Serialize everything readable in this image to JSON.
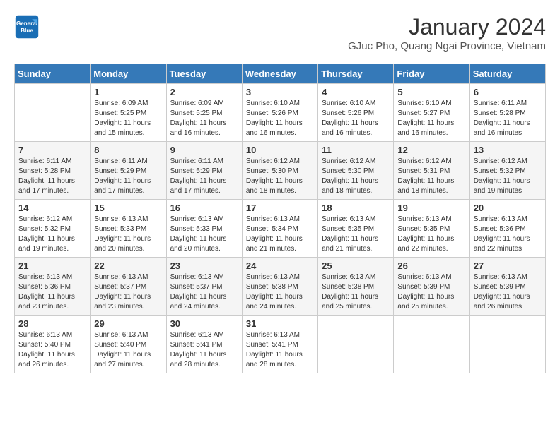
{
  "logo": {
    "line1": "General",
    "line2": "Blue"
  },
  "title": "January 2024",
  "location": "GJuc Pho, Quang Ngai Province, Vietnam",
  "days_of_week": [
    "Sunday",
    "Monday",
    "Tuesday",
    "Wednesday",
    "Thursday",
    "Friday",
    "Saturday"
  ],
  "weeks": [
    [
      {
        "day": "",
        "sunrise": "",
        "sunset": "",
        "daylight": ""
      },
      {
        "day": "1",
        "sunrise": "6:09 AM",
        "sunset": "5:25 PM",
        "daylight": "11 hours and 15 minutes."
      },
      {
        "day": "2",
        "sunrise": "6:09 AM",
        "sunset": "5:25 PM",
        "daylight": "11 hours and 16 minutes."
      },
      {
        "day": "3",
        "sunrise": "6:10 AM",
        "sunset": "5:26 PM",
        "daylight": "11 hours and 16 minutes."
      },
      {
        "day": "4",
        "sunrise": "6:10 AM",
        "sunset": "5:26 PM",
        "daylight": "11 hours and 16 minutes."
      },
      {
        "day": "5",
        "sunrise": "6:10 AM",
        "sunset": "5:27 PM",
        "daylight": "11 hours and 16 minutes."
      },
      {
        "day": "6",
        "sunrise": "6:11 AM",
        "sunset": "5:28 PM",
        "daylight": "11 hours and 16 minutes."
      }
    ],
    [
      {
        "day": "7",
        "sunrise": "6:11 AM",
        "sunset": "5:28 PM",
        "daylight": "11 hours and 17 minutes."
      },
      {
        "day": "8",
        "sunrise": "6:11 AM",
        "sunset": "5:29 PM",
        "daylight": "11 hours and 17 minutes."
      },
      {
        "day": "9",
        "sunrise": "6:11 AM",
        "sunset": "5:29 PM",
        "daylight": "11 hours and 17 minutes."
      },
      {
        "day": "10",
        "sunrise": "6:12 AM",
        "sunset": "5:30 PM",
        "daylight": "11 hours and 18 minutes."
      },
      {
        "day": "11",
        "sunrise": "6:12 AM",
        "sunset": "5:30 PM",
        "daylight": "11 hours and 18 minutes."
      },
      {
        "day": "12",
        "sunrise": "6:12 AM",
        "sunset": "5:31 PM",
        "daylight": "11 hours and 18 minutes."
      },
      {
        "day": "13",
        "sunrise": "6:12 AM",
        "sunset": "5:32 PM",
        "daylight": "11 hours and 19 minutes."
      }
    ],
    [
      {
        "day": "14",
        "sunrise": "6:12 AM",
        "sunset": "5:32 PM",
        "daylight": "11 hours and 19 minutes."
      },
      {
        "day": "15",
        "sunrise": "6:13 AM",
        "sunset": "5:33 PM",
        "daylight": "11 hours and 20 minutes."
      },
      {
        "day": "16",
        "sunrise": "6:13 AM",
        "sunset": "5:33 PM",
        "daylight": "11 hours and 20 minutes."
      },
      {
        "day": "17",
        "sunrise": "6:13 AM",
        "sunset": "5:34 PM",
        "daylight": "11 hours and 21 minutes."
      },
      {
        "day": "18",
        "sunrise": "6:13 AM",
        "sunset": "5:35 PM",
        "daylight": "11 hours and 21 minutes."
      },
      {
        "day": "19",
        "sunrise": "6:13 AM",
        "sunset": "5:35 PM",
        "daylight": "11 hours and 22 minutes."
      },
      {
        "day": "20",
        "sunrise": "6:13 AM",
        "sunset": "5:36 PM",
        "daylight": "11 hours and 22 minutes."
      }
    ],
    [
      {
        "day": "21",
        "sunrise": "6:13 AM",
        "sunset": "5:36 PM",
        "daylight": "11 hours and 23 minutes."
      },
      {
        "day": "22",
        "sunrise": "6:13 AM",
        "sunset": "5:37 PM",
        "daylight": "11 hours and 23 minutes."
      },
      {
        "day": "23",
        "sunrise": "6:13 AM",
        "sunset": "5:37 PM",
        "daylight": "11 hours and 24 minutes."
      },
      {
        "day": "24",
        "sunrise": "6:13 AM",
        "sunset": "5:38 PM",
        "daylight": "11 hours and 24 minutes."
      },
      {
        "day": "25",
        "sunrise": "6:13 AM",
        "sunset": "5:38 PM",
        "daylight": "11 hours and 25 minutes."
      },
      {
        "day": "26",
        "sunrise": "6:13 AM",
        "sunset": "5:39 PM",
        "daylight": "11 hours and 25 minutes."
      },
      {
        "day": "27",
        "sunrise": "6:13 AM",
        "sunset": "5:39 PM",
        "daylight": "11 hours and 26 minutes."
      }
    ],
    [
      {
        "day": "28",
        "sunrise": "6:13 AM",
        "sunset": "5:40 PM",
        "daylight": "11 hours and 26 minutes."
      },
      {
        "day": "29",
        "sunrise": "6:13 AM",
        "sunset": "5:40 PM",
        "daylight": "11 hours and 27 minutes."
      },
      {
        "day": "30",
        "sunrise": "6:13 AM",
        "sunset": "5:41 PM",
        "daylight": "11 hours and 28 minutes."
      },
      {
        "day": "31",
        "sunrise": "6:13 AM",
        "sunset": "5:41 PM",
        "daylight": "11 hours and 28 minutes."
      },
      {
        "day": "",
        "sunrise": "",
        "sunset": "",
        "daylight": ""
      },
      {
        "day": "",
        "sunrise": "",
        "sunset": "",
        "daylight": ""
      },
      {
        "day": "",
        "sunrise": "",
        "sunset": "",
        "daylight": ""
      }
    ]
  ]
}
